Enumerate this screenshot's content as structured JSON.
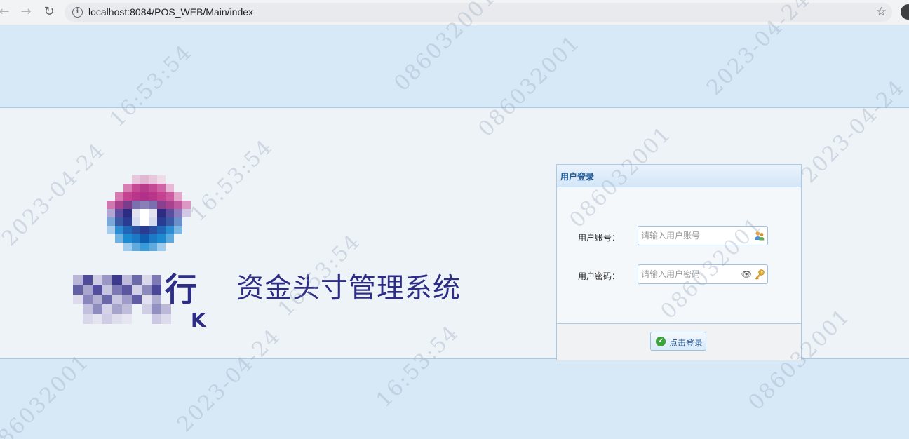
{
  "browser": {
    "url": "localhost:8084/POS_WEB/Main/index",
    "back_icon": "←",
    "forward_icon": "→",
    "reload_icon": "↻",
    "info_icon": "i",
    "star_icon": "☆"
  },
  "branding": {
    "bank_char": "行",
    "bank_k": "K",
    "system_title": "资金头寸管理系统"
  },
  "login": {
    "panel_title": "用户登录",
    "username_label": "用户账号：",
    "username_placeholder": "请输入用户账号",
    "password_label": "用户密码：",
    "password_placeholder": "请输入用户密码",
    "eye_icon": "👁",
    "submit_label": "点击登录",
    "check_icon": "✔"
  },
  "watermark": {
    "id": "086032001",
    "date": "2023-04-24",
    "time": "16:53:54"
  },
  "colors": {
    "band": "#d7e8f7",
    "middle": "#eef3f8",
    "accent": "#2d2d86",
    "panel_border": "#a9cbe8"
  }
}
